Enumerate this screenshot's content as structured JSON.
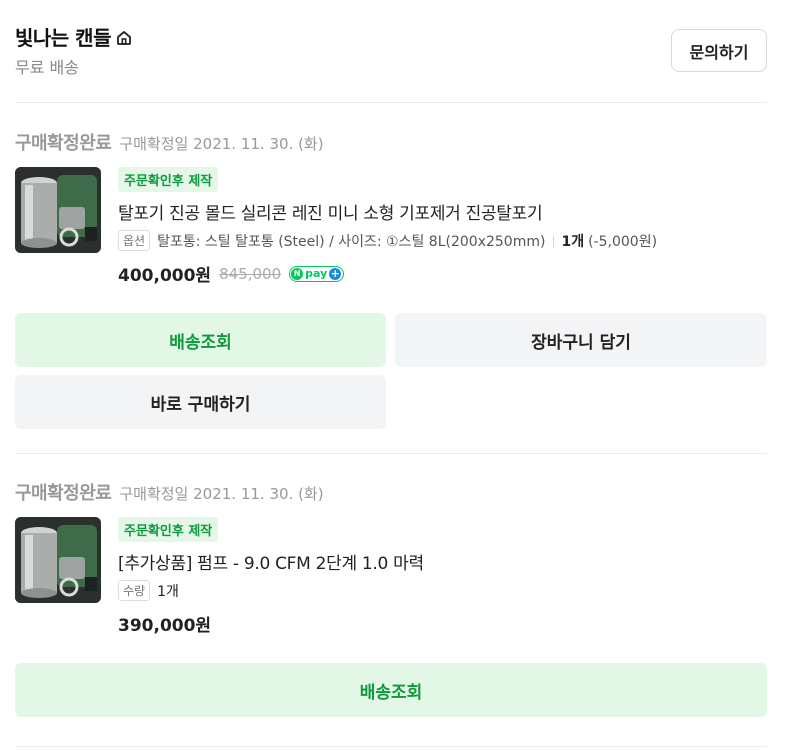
{
  "store": {
    "name": "빛나는 캔들",
    "shipping": "무료 배송",
    "inquiry_button": "문의하기"
  },
  "orders": [
    {
      "status": "구매확정완료",
      "date": "구매확정일 2021. 11. 30. (화)",
      "badge": "주문확인후 제작",
      "title": "탈포기 진공 몰드 실리콘 레진 미니 소형 기포제거 진공탈포기",
      "option_tag": "옵션",
      "option_text": "탈포통: 스틸 탈포통 (Steel) / 사이즈: ①스틸 8L(200x250mm)",
      "quantity": "1개",
      "quantity_note": "(-5,000원)",
      "price": "400,000원",
      "original_price": "845,000",
      "pay_badge": {
        "n": "N",
        "label": "pay",
        "plus": "+"
      },
      "buttons": [
        "배송조회",
        "장바구니 담기",
        "바로 구매하기"
      ]
    },
    {
      "status": "구매확정완료",
      "date": "구매확정일 2021. 11. 30. (화)",
      "badge": "주문확인후 제작",
      "title": "[추가상품] 펌프 - 9.0 CFM 2단계 1.0 마력",
      "option_tag": "수량",
      "quantity": "1개",
      "price": "390,000원",
      "buttons": [
        "배송조회"
      ]
    }
  ],
  "colors": {
    "accent_green": "#0e9a3a",
    "green_bg": "#e3f7e6",
    "gray_bg": "#f3f4f6",
    "npay_green": "#03c75a"
  }
}
